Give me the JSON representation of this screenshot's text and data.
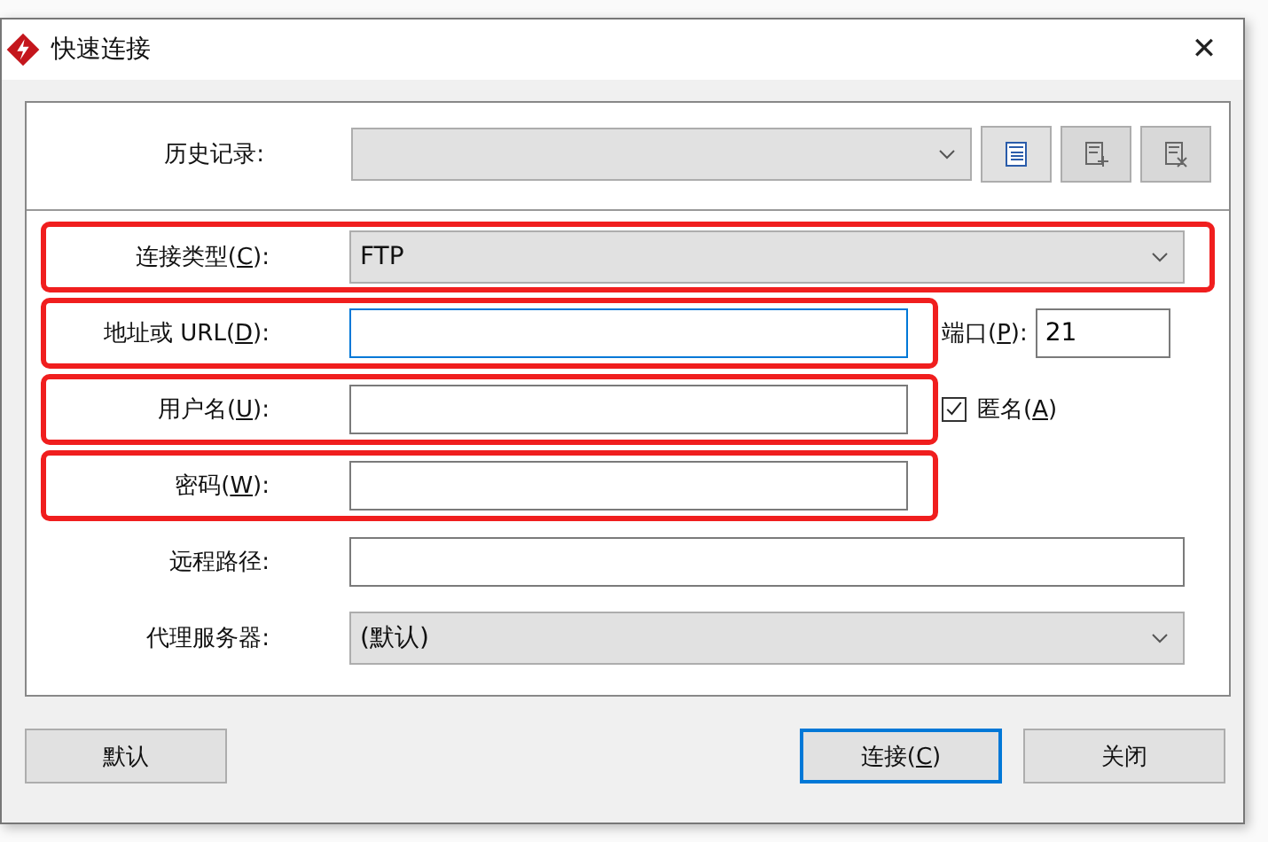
{
  "window": {
    "title": "快速连接",
    "close": "✕"
  },
  "history": {
    "label": "历史记录:"
  },
  "rows": [
    {
      "kind": "select",
      "label": "连接类型(C):",
      "value": "FTP",
      "highlighted": true
    },
    {
      "kind": "text",
      "label": "地址或 URL(D):",
      "value": "",
      "focused": true,
      "highlighted": true,
      "extra": {
        "kind": "port",
        "label": "端口(P):",
        "value": "21"
      }
    },
    {
      "kind": "text",
      "label": "用户名(U):",
      "value": "",
      "focused": false,
      "highlighted": true,
      "extra": {
        "kind": "checkbox",
        "label": "匿名(A)",
        "checked": true
      }
    },
    {
      "kind": "text",
      "label": "密码(W):",
      "value": "",
      "focused": false,
      "highlighted": true
    },
    {
      "kind": "text",
      "label": "远程路径:",
      "value": "",
      "focused": false,
      "highlighted": false
    },
    {
      "kind": "select",
      "label": "代理服务器:",
      "value": "(默认)",
      "highlighted": false
    }
  ],
  "buttons": [
    {
      "label": "默认",
      "default": false
    },
    {
      "label": "连接(C)",
      "default": true
    },
    {
      "label": "关闭",
      "default": false
    }
  ]
}
